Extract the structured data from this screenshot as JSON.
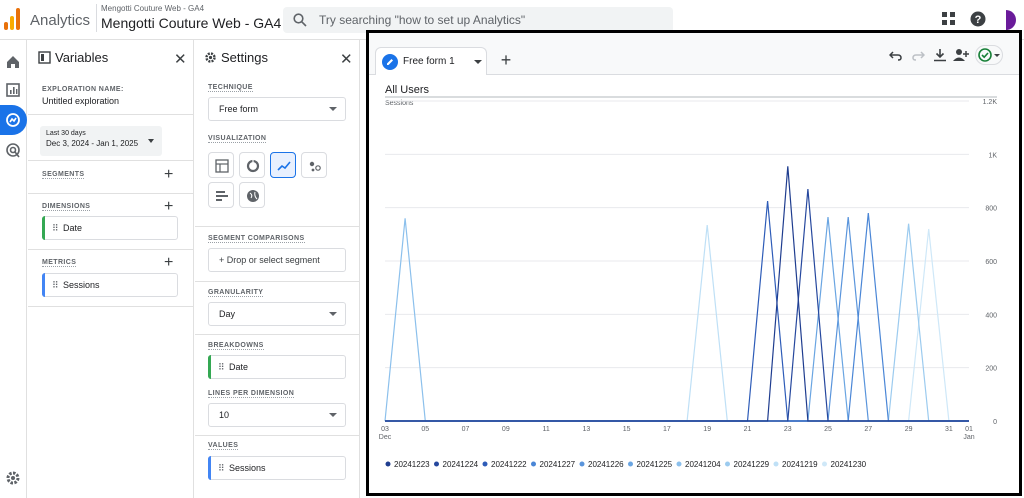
{
  "topbar": {
    "app_name": "Analytics",
    "property_account": "Mengotti Couture Web - GA4",
    "property_name": "Mengotti Couture Web - GA4",
    "search_placeholder": "Try searching \"how to set up Analytics\"",
    "icons": [
      "apps-grid-icon",
      "help-icon",
      "account-avatar"
    ]
  },
  "nav": {
    "items": [
      "home-icon",
      "reports-icon",
      "explore-icon",
      "advertising-icon"
    ],
    "active": "explore-icon",
    "bottom": "settings-gear-icon"
  },
  "variables": {
    "title": "Variables",
    "exploration_name_label": "EXPLORATION NAME:",
    "exploration_name": "Untitled exploration",
    "date_range_label": "Last 30 days",
    "date_range_value": "Dec 3, 2024 - Jan 1, 2025",
    "segments_label": "SEGMENTS",
    "dimensions_label": "DIMENSIONS",
    "dimensions": [
      "Date"
    ],
    "metrics_label": "METRICS",
    "metrics": [
      "Sessions"
    ]
  },
  "settings": {
    "title": "Settings",
    "technique_label": "TECHNIQUE",
    "technique": "Free form",
    "visualization_label": "VISUALIZATION",
    "segment_comparisons_label": "SEGMENT COMPARISONS",
    "segment_drop": "+ Drop or select segment",
    "granularity_label": "GRANULARITY",
    "granularity": "Day",
    "breakdowns_label": "BREAKDOWNS",
    "breakdown": "Date",
    "lines_per_dimension_label": "LINES PER DIMENSION",
    "lines_per_dimension": "10",
    "values_label": "VALUES",
    "value": "Sessions"
  },
  "canvas": {
    "tab_label": "Free form 1",
    "segment_title": "All Users"
  },
  "chart_data": {
    "type": "line",
    "title": "",
    "ylabel": "Sessions",
    "ylim": [
      0,
      1200
    ],
    "y_ticks": [
      "0",
      "200",
      "400",
      "600",
      "800",
      "1K",
      "1.2K"
    ],
    "x_tick_labels": [
      {
        "day": 3,
        "label": "03",
        "sub": "Dec"
      },
      {
        "day": 5,
        "label": "05",
        "sub": ""
      },
      {
        "day": 7,
        "label": "07",
        "sub": ""
      },
      {
        "day": 9,
        "label": "09",
        "sub": ""
      },
      {
        "day": 11,
        "label": "11",
        "sub": ""
      },
      {
        "day": 13,
        "label": "13",
        "sub": ""
      },
      {
        "day": 15,
        "label": "15",
        "sub": ""
      },
      {
        "day": 17,
        "label": "17",
        "sub": ""
      },
      {
        "day": 19,
        "label": "19",
        "sub": ""
      },
      {
        "day": 21,
        "label": "21",
        "sub": ""
      },
      {
        "day": 23,
        "label": "23",
        "sub": ""
      },
      {
        "day": 25,
        "label": "25",
        "sub": ""
      },
      {
        "day": 27,
        "label": "27",
        "sub": ""
      },
      {
        "day": 29,
        "label": "29",
        "sub": ""
      },
      {
        "day": 31,
        "label": "31",
        "sub": ""
      },
      {
        "day": 32,
        "label": "01",
        "sub": "Jan"
      }
    ],
    "x_range": [
      3,
      32
    ],
    "grid": true,
    "legend_position": "bottom",
    "series": [
      {
        "name": "20241223",
        "color": "#1f3d8f",
        "peak_day": 23,
        "value": 955
      },
      {
        "name": "20241224",
        "color": "#26489e",
        "peak_day": 24,
        "value": 870
      },
      {
        "name": "20241222",
        "color": "#2e5cb8",
        "peak_day": 22,
        "value": 825
      },
      {
        "name": "20241227",
        "color": "#4a86d6",
        "peak_day": 27,
        "value": 780
      },
      {
        "name": "20241226",
        "color": "#5a95dc",
        "peak_day": 26,
        "value": 765
      },
      {
        "name": "20241225",
        "color": "#6aa5e2",
        "peak_day": 25,
        "value": 765
      },
      {
        "name": "20241204",
        "color": "#8cc0ec",
        "peak_day": 4,
        "value": 760
      },
      {
        "name": "20241229",
        "color": "#9ccbef",
        "peak_day": 29,
        "value": 740
      },
      {
        "name": "20241219",
        "color": "#bfe0f6",
        "peak_day": 19,
        "value": 735
      },
      {
        "name": "20241230",
        "color": "#cfe8f8",
        "peak_day": 30,
        "value": 720
      }
    ]
  }
}
